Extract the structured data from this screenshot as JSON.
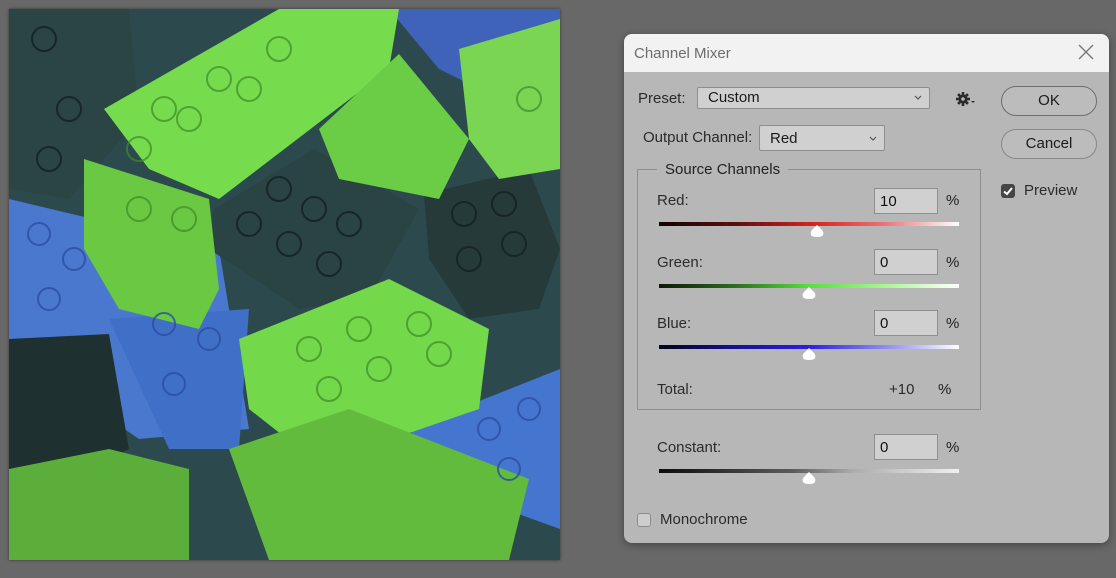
{
  "canvas": {
    "description": "Green, blue and dark teal toy bricks image with Channel Mixer preview applied"
  },
  "dialog": {
    "title": "Channel Mixer",
    "close_icon": "close-icon",
    "preset": {
      "label": "Preset:",
      "value": "Custom"
    },
    "settings_icon": "gear-icon",
    "output_channel": {
      "label": "Output Channel:",
      "value": "Red"
    },
    "buttons": {
      "ok": "OK",
      "cancel": "Cancel"
    },
    "preview": {
      "label": "Preview",
      "checked": true
    },
    "source_channels": {
      "legend": "Source Channels",
      "channels": [
        {
          "name": "red",
          "label": "Red:",
          "value": "10",
          "unit": "%",
          "slider_percent": 10,
          "color": "#d7241f"
        },
        {
          "name": "green",
          "label": "Green:",
          "value": "0",
          "unit": "%",
          "slider_percent": 0,
          "color": "#55e03c"
        },
        {
          "name": "blue",
          "label": "Blue:",
          "value": "0",
          "unit": "%",
          "slider_percent": 0,
          "color": "#2a1fe6"
        }
      ],
      "total": {
        "label": "Total:",
        "value": "+10",
        "unit": "%"
      }
    },
    "constant": {
      "label": "Constant:",
      "value": "0",
      "unit": "%",
      "slider_percent": 0
    },
    "monochrome": {
      "label": "Monochrome",
      "checked": false
    }
  }
}
